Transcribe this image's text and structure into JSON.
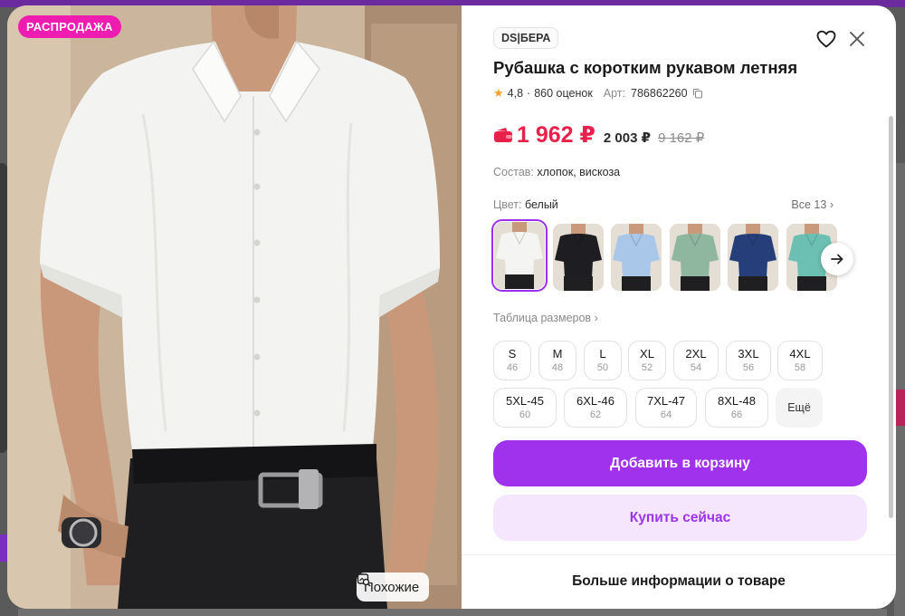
{
  "product": {
    "sale_badge": "РАСПРОДАЖА",
    "similar_label": "Похожие",
    "brand": "DS|БЕРА",
    "title": "Рубашка с коротким рукавом летняя",
    "rating": "4,8",
    "reviews": "860 оценок",
    "separator": "·",
    "article_label": "Арт:",
    "article_number": "786862260",
    "price_main": "1 962 ₽",
    "price_alt": "2 003 ₽",
    "price_old": "9 162 ₽",
    "composition_label": "Состав:",
    "composition_value": "хлопок, вискоза",
    "color_label": "Цвет:",
    "color_value": "белый",
    "colors_all": "Все 13",
    "size_table_link": "Таблица размеров",
    "add_to_cart": "Добавить в корзину",
    "buy_now": "Купить сейчас",
    "more_info": "Больше информации о товаре"
  },
  "colors": [
    {
      "name": "white",
      "hex": "#f4f4f2",
      "selected": true
    },
    {
      "name": "black",
      "hex": "#1d1d22"
    },
    {
      "name": "light-blue",
      "hex": "#a9c7e8"
    },
    {
      "name": "sage-green",
      "hex": "#8fb7a0"
    },
    {
      "name": "navy",
      "hex": "#263e7a"
    },
    {
      "name": "teal",
      "hex": "#6cc0b3"
    }
  ],
  "sizes": [
    {
      "label": "S",
      "num": "46"
    },
    {
      "label": "M",
      "num": "48"
    },
    {
      "label": "L",
      "num": "50"
    },
    {
      "label": "XL",
      "num": "52"
    },
    {
      "label": "2XL",
      "num": "54"
    },
    {
      "label": "3XL",
      "num": "56"
    },
    {
      "label": "4XL",
      "num": "58"
    },
    {
      "label": "5XL-45",
      "num": "60"
    },
    {
      "label": "6XL-46",
      "num": "62"
    },
    {
      "label": "7XL-47",
      "num": "64"
    },
    {
      "label": "8XL-48",
      "num": "66"
    },
    {
      "label": "Ещё",
      "num": ""
    }
  ],
  "icons": {
    "star": "star-icon",
    "copy": "copy-icon",
    "wallet": "wallet-icon",
    "heart": "heart-icon",
    "close": "close-icon",
    "next": "arrow-right-icon",
    "chevron": "chevron-right-icon",
    "similar": "image-search-icon"
  },
  "theme": {
    "accent": "#a032ee",
    "accent_soft": "#f5e6fd",
    "sale_pink": "#ee1cb1",
    "price_red": "#e8214b",
    "star_orange": "#f3a126"
  }
}
